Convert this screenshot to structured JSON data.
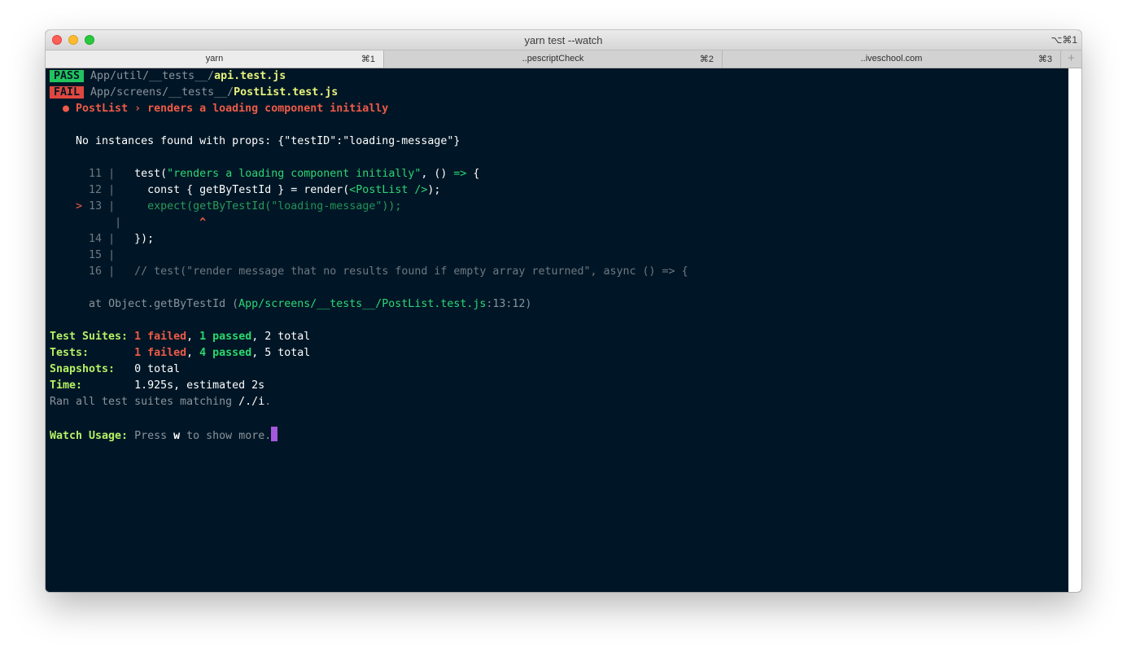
{
  "window": {
    "title": "yarn test --watch",
    "shortcut": "⌥⌘1"
  },
  "tabs": [
    {
      "label": "yarn",
      "key": "⌘1",
      "active": true
    },
    {
      "label": "..pescriptCheck",
      "key": "⌘2",
      "active": false
    },
    {
      "label": "..iveschool.com",
      "key": "⌘3",
      "active": false
    }
  ],
  "new_tab": "+",
  "terminal": {
    "pass_badge": "PASS",
    "pass_dir": "App/util/__tests__/",
    "pass_file": "api.test.js",
    "fail_badge": "FAIL",
    "fail_dir": "App/screens/__tests__/",
    "fail_file": "PostList.test.js",
    "failure_title": "● PostList › renders a loading component initially",
    "error_message": "No instances found with props: {\"testID\":\"loading-message\"}",
    "code": {
      "l11_num": "11",
      "l11_a": "test(",
      "l11_str": "\"renders a loading component initially\"",
      "l11_b": ", () ",
      "l11_arrow": "=>",
      "l11_c": " {",
      "l12_num": "12",
      "l12_a": "const { getByTestId } = render(",
      "l12_tag": "<PostList />",
      "l12_b": ");",
      "l13_marker": ">",
      "l13_num": "13",
      "l13_a": "expect(getByTestId(",
      "l13_str": "\"loading-message\"",
      "l13_b": "));",
      "caret": "^",
      "l14_num": "14",
      "l14_a": "});",
      "l15_num": "15",
      "l16_num": "16",
      "l16_comment": "// test(\"render message that no results found if empty array returned\", async () => {"
    },
    "stack_prefix": "at Object.getByTestId (",
    "stack_path": "App/screens/__tests__/PostList.test.js",
    "stack_loc": ":13:12)",
    "summary": {
      "suites_label": "Test Suites:",
      "suites_failed": "1 failed",
      "suites_passed": "1 passed",
      "suites_total": "2 total",
      "tests_label": "Tests:",
      "tests_failed": "1 failed",
      "tests_passed": "4 passed",
      "tests_total": "5 total",
      "snapshots_label": "Snapshots:",
      "snapshots_total": "0 total",
      "time_label": "Time:",
      "time_value": "1.925s, estimated 2s",
      "ran_prefix": "Ran all test suites matching ",
      "ran_pattern": "/./i",
      "ran_suffix": "."
    },
    "watch_label": "Watch Usage:",
    "watch_prefix": " Press ",
    "watch_key": "w",
    "watch_suffix": " to show more."
  }
}
